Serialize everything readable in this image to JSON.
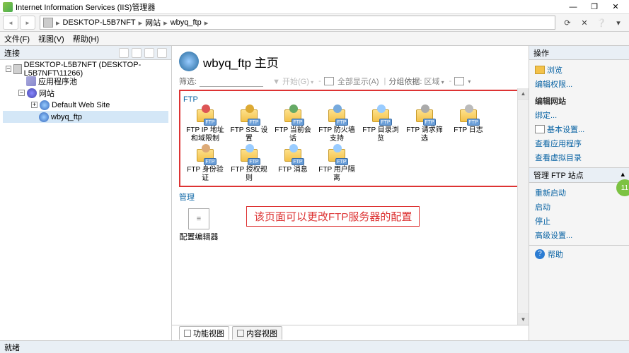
{
  "titlebar": {
    "title": "Internet Information Services (IIS)管理器"
  },
  "breadcrumb": {
    "server": "DESKTOP-L5B7NFT",
    "level1": "网站",
    "level2": "wbyq_ftp"
  },
  "menubar": {
    "file": "文件(F)",
    "view": "视图(V)",
    "help": "帮助(H)"
  },
  "left": {
    "title": "连接",
    "server_node": "DESKTOP-L5B7NFT (DESKTOP-L5B7NFT\\11266)",
    "app_pools": "应用程序池",
    "sites": "网站",
    "default_site": "Default Web Site",
    "wbyq": "wbyq_ftp"
  },
  "center": {
    "heading": "wbyq_ftp 主页",
    "filter_label": "筛选:",
    "go": "开始(G)",
    "show_all": "全部显示(A)",
    "group_by": "分组依据:",
    "group_area": "区域",
    "ftp_group": "FTP",
    "ftp_items": [
      {
        "label": "FTP IP 地址和域限制",
        "color": "#d55"
      },
      {
        "label": "FTP SSL 设置",
        "color": "#da3"
      },
      {
        "label": "FTP 当前会话",
        "color": "#6a6"
      },
      {
        "label": "FTP 防火墙支持",
        "color": "#7ad"
      },
      {
        "label": "FTP 目录浏览",
        "color": "#9cf"
      },
      {
        "label": "FTP 请求筛选",
        "color": "#aaa"
      },
      {
        "label": "FTP 日志",
        "color": "#bbb"
      },
      {
        "label": "FTP 身份验证",
        "color": "#da7"
      },
      {
        "label": "FTP 授权规则",
        "color": "#9cf"
      },
      {
        "label": "FTP 消息",
        "color": "#9cf"
      },
      {
        "label": "FTP 用户隔离",
        "color": "#9cf"
      }
    ],
    "mgmt_group": "管理",
    "config_editor": "配置编辑器",
    "annotation": "该页面可以更改FTP服务器的配置",
    "tab_features": "功能视图",
    "tab_content": "内容视图"
  },
  "right": {
    "title": "操作",
    "explore": "浏览",
    "edit_perm": "编辑权限...",
    "edit_site": "编辑网站",
    "bindings": "绑定...",
    "basic": "基本设置...",
    "view_apps": "查看应用程序",
    "view_vdirs": "查看虚拟目录",
    "manage_site": "管理 FTP 站点",
    "restart": "重新启动",
    "start": "启动",
    "stop": "停止",
    "advanced": "高级设置...",
    "help": "帮助"
  },
  "statusbar": {
    "ready": "就绪"
  },
  "fab_text": "11"
}
